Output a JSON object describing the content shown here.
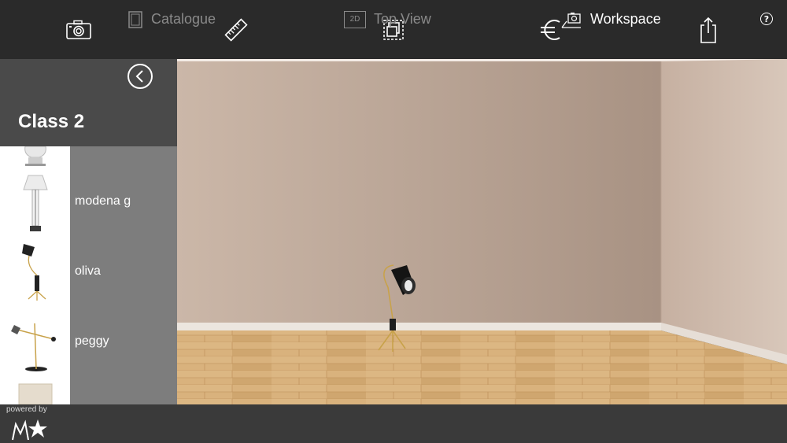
{
  "toolbar": {
    "icons": [
      "camera-icon",
      "ruler-icon",
      "layers-icon",
      "euro-icon",
      "share-icon",
      "help-icon"
    ],
    "help_label": "?"
  },
  "panel": {
    "title": "Class 2",
    "items": [
      {
        "label": "modena g"
      },
      {
        "label": "oliva"
      },
      {
        "label": "peggy"
      }
    ]
  },
  "bottom": {
    "powered_by": "powered by",
    "tabs": [
      {
        "label": "Catalogue",
        "state": "inactive"
      },
      {
        "label": "Top View",
        "state": "inactive",
        "badge": "2D"
      },
      {
        "label": "Workspace",
        "state": "active"
      }
    ]
  },
  "colors": {
    "topbar": "#2a2a2a",
    "panel_header": "#4a4a4a",
    "list_bg": "#7d7d7d",
    "bottombar": "#3a3a3a",
    "wall": "#c9b5a6",
    "floor": "#d7ae7a"
  }
}
